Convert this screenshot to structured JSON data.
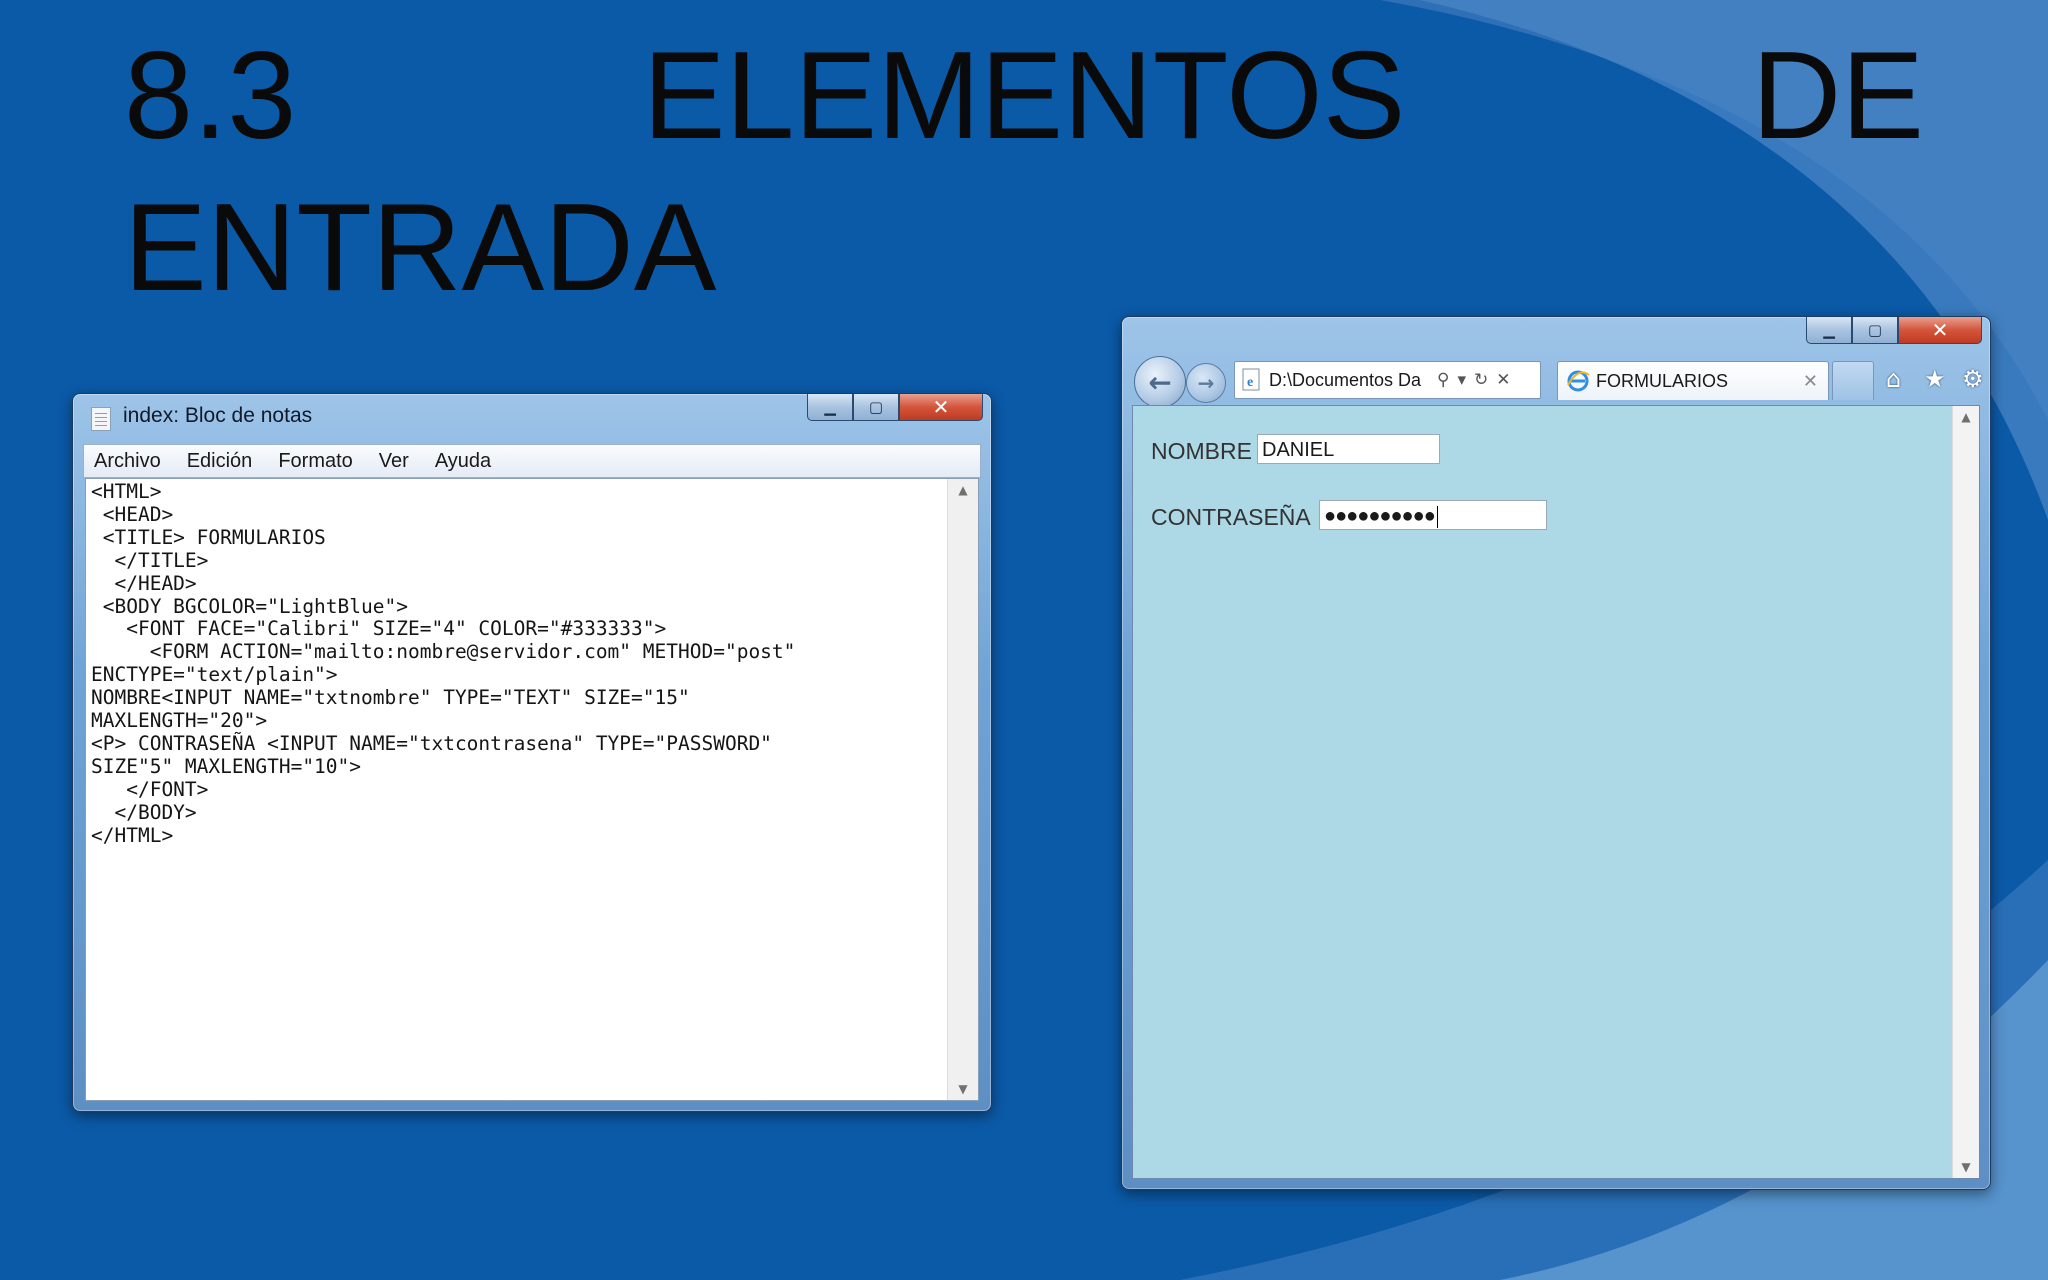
{
  "slide": {
    "title_number": "8.3",
    "title_word1": "ELEMENTOS",
    "title_word2": "DE",
    "title_line2": "ENTRADA"
  },
  "notepad": {
    "title": "index: Bloc de notas",
    "menu": [
      "Archivo",
      "Edición",
      "Formato",
      "Ver",
      "Ayuda"
    ],
    "code_lines": [
      "<HTML>",
      " <HEAD>",
      " <TITLE> FORMULARIOS",
      "  </TITLE>",
      "  </HEAD>",
      " <BODY BGCOLOR=\"LightBlue\">",
      "   <FONT FACE=\"Calibri\" SIZE=\"4\" COLOR=\"#333333\">",
      "     <FORM ACTION=\"mailto:nombre@servidor.com\" METHOD=\"post\"",
      "ENCTYPE=\"text/plain\">",
      "NOMBRE<INPUT NAME=\"txtnombre\" TYPE=\"TEXT\" SIZE=\"15\"",
      "MAXLENGTH=\"20\">",
      "<P> CONTRASEÑA <INPUT NAME=\"txtcontrasena\" TYPE=\"PASSWORD\"",
      "SIZE\"5\" MAXLENGTH=\"10\">",
      "   </FONT>",
      "  </BODY>",
      "</HTML>"
    ]
  },
  "browser": {
    "address": "D:\\Documentos Da",
    "tab_title": "FORMULARIOS",
    "background_color": "#add8e6",
    "form": {
      "nombre_label": "NOMBRE",
      "nombre_value": "DANIEL",
      "password_label": "CONTRASEÑA",
      "password_mask": "●●●●●●●●●●"
    }
  },
  "icons": {
    "notepad": "notepad-icon",
    "back": "back-arrow-icon",
    "forward": "forward-arrow-icon",
    "ie": "internet-explorer-icon",
    "search": "search-icon",
    "refresh": "refresh-icon",
    "stop": "stop-icon",
    "home": "home-icon",
    "favorites": "star-icon",
    "tools": "gear-icon"
  },
  "colors": {
    "slide_bg": "#0b5aa8",
    "swoosh": "#4a86c6",
    "close_button": "#c94a30"
  }
}
